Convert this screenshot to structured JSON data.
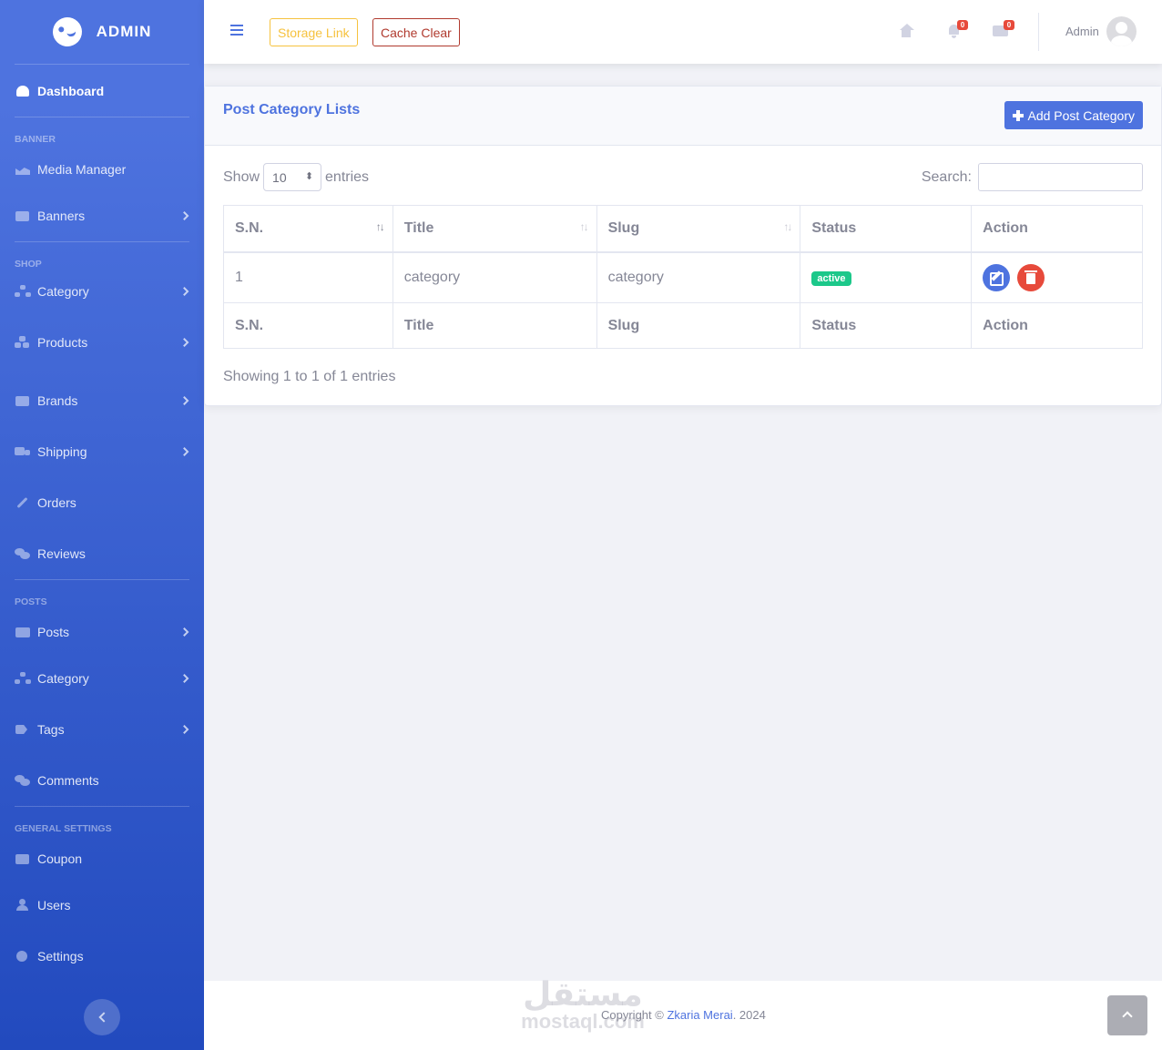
{
  "sidebar": {
    "brand": "ADMIN",
    "dashboard": "Dashboard",
    "headings": {
      "banner": "BANNER",
      "shop": "SHOP",
      "posts": "POSTS",
      "general": "GENERAL SETTINGS"
    },
    "items": {
      "media_manager": "Media Manager",
      "banners": "Banners",
      "category": "Category",
      "products": "Products",
      "brands": "Brands",
      "shipping": "Shipping",
      "orders": "Orders",
      "reviews": "Reviews",
      "posts": "Posts",
      "post_category": "Category",
      "tags": "Tags",
      "comments": "Comments",
      "coupon": "Coupon",
      "users": "Users",
      "settings": "Settings"
    }
  },
  "topbar": {
    "storage_link": "Storage Link",
    "cache_clear": "Cache Clear",
    "notifications_count": "0",
    "messages_count": "0",
    "user_name": "Admin"
  },
  "card": {
    "title": "Post Category Lists",
    "add_button": "Add Post Category",
    "show_label": "Show",
    "entries_label": "entries",
    "page_length": "10",
    "search_label": "Search:",
    "info": "Showing 1 to 1 of 1 entries"
  },
  "table": {
    "headers": [
      "S.N.",
      "Title",
      "Slug",
      "Status",
      "Action"
    ],
    "rows": [
      {
        "sn": "1",
        "title": "category",
        "slug": "category",
        "status": "active"
      }
    ]
  },
  "footer": {
    "copyright_prefix": "Copyright © ",
    "author": "Zkaria Merai",
    "year_suffix": ". 2024",
    "watermark_arabic": "مستقل",
    "watermark_latin": "mostaql.com"
  },
  "colors": {
    "primary": "#4e73df",
    "success": "#1cc88a",
    "danger": "#e74a3b",
    "warning": "#f6c23e"
  }
}
